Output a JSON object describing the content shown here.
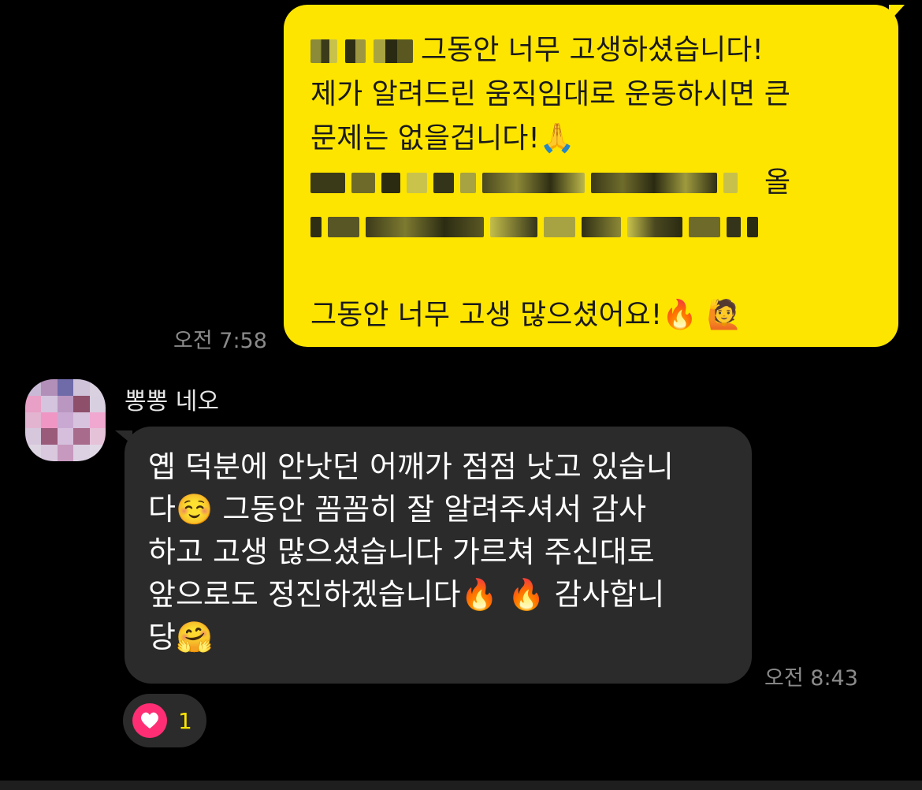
{
  "colors": {
    "background": "#000000",
    "outgoing_bubble": "#FEE500",
    "incoming_bubble": "#2b2b2b",
    "timestamp": "#8a8a8a",
    "reaction_heart": "#ff2e74",
    "reaction_count": "#FEE500"
  },
  "outgoing": {
    "line1_text": "그동안 너무 고생하셨습니다!",
    "line2_text": "제가 알려드린 움직임대로 운동하시면 큰",
    "line3_text": "문제는 없을겁니다!",
    "line3_emoji": "🙏",
    "line4_tail": "올",
    "line6_text": "그동안 너무 고생 많으셨어요!",
    "line6_emoji": "🔥 🙋",
    "time": "오전 7:58",
    "redacted_icon": "pixelated-redaction"
  },
  "incoming": {
    "sender_name": "뽕뽕 네오",
    "avatar_icon": "pixelated-avatar",
    "line1": "옙 덕분에 안낫던 어깨가 점점 낫고 있습니",
    "line2_a": "다",
    "line2_emoji": "☺️",
    "line2_b": " 그동안 꼼꼼히 잘 알려주셔서 감사",
    "line3": "하고 고생 많으셨습니다 가르쳐 주신대로",
    "line4_a": "앞으로도 정진하겠습니다",
    "line4_emoji": "🔥 🔥",
    "line4_b": "  감사합니",
    "line5_a": "당",
    "line5_emoji": "🤗",
    "time": "오전 8:43"
  },
  "reaction": {
    "icon": "heart-icon",
    "count": "1"
  }
}
